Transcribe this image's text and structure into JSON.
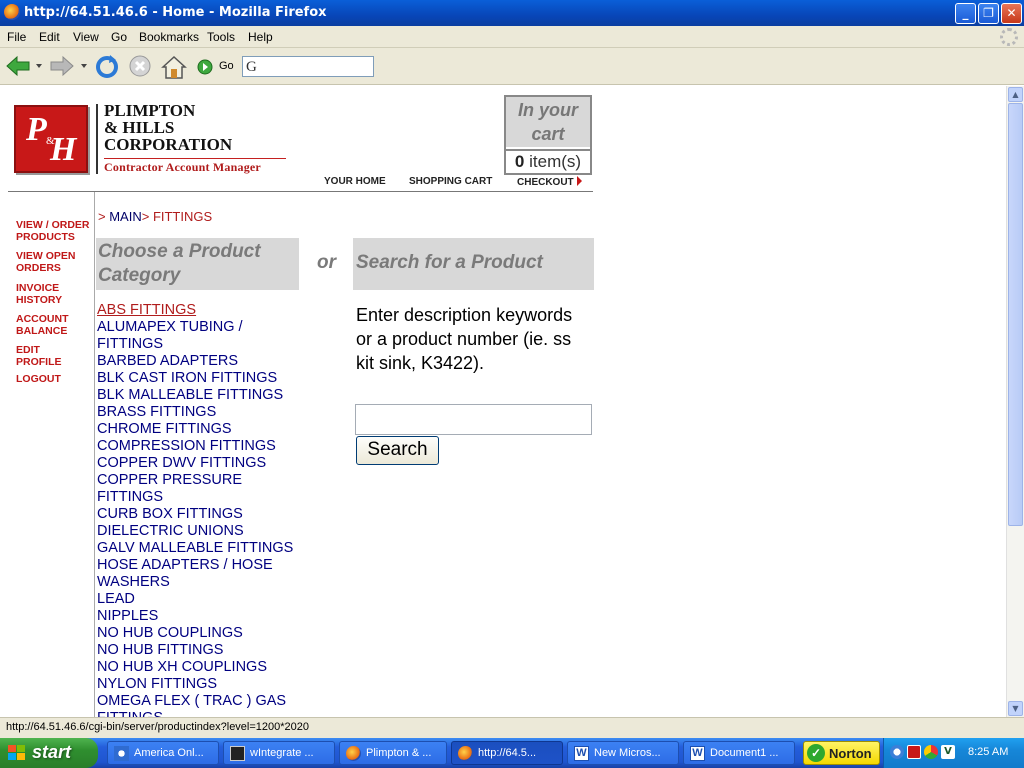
{
  "window": {
    "title": "http://64.51.46.6 - Home - Mozilla Firefox"
  },
  "menu": [
    "File",
    "Edit",
    "View",
    "Go",
    "Bookmarks",
    "Tools",
    "Help"
  ],
  "toolbar": {
    "go_label": "Go",
    "address_value": ""
  },
  "logo": {
    "initial_p": "P",
    "initial_amp": "&",
    "initial_h": "H"
  },
  "company": {
    "name": "PLIMPTON\n& HILLS\nCORPORATION",
    "tagline": "Contractor Account Manager"
  },
  "cart": {
    "heading": "In your cart",
    "count": "0",
    "unit": "item(s)"
  },
  "top_nav": {
    "home": "YOUR HOME",
    "cart": "SHOPPING CART",
    "checkout": "CHECKOUT"
  },
  "sidebar": [
    "VIEW / ORDER PRODUCTS",
    "VIEW OPEN ORDERS",
    "INVOICE HISTORY",
    "ACCOUNT BALANCE",
    "EDIT PROFILE",
    "LOGOUT"
  ],
  "breadcrumb": {
    "prefix": "> ",
    "main": "MAIN",
    "sep": "> ",
    "current": "FITTINGS"
  },
  "category_panel": {
    "heading": "Choose a Product Category",
    "or": "or",
    "items": [
      "ABS FITTINGS",
      "ALUMAPEX TUBING / FITTINGS",
      "BARBED ADAPTERS",
      "BLK CAST IRON FITTINGS",
      "BLK MALLEABLE FITTINGS",
      "BRASS FITTINGS",
      "CHROME FITTINGS",
      "COMPRESSION FITTINGS",
      "COPPER DWV FITTINGS",
      "COPPER PRESSURE FITTINGS",
      "CURB BOX FITTINGS",
      "DIELECTRIC UNIONS",
      "GALV MALLEABLE FITTINGS",
      "HOSE ADAPTERS / HOSE WASHERS",
      "LEAD",
      "NIPPLES",
      "NO HUB COUPLINGS",
      "NO HUB FITTINGS",
      "NO HUB XH COUPLINGS",
      "NYLON FITTINGS",
      "OMEGA FLEX ( TRAC ) GAS FITTINGS"
    ]
  },
  "search_panel": {
    "heading": "Search for a Product",
    "description": "Enter description keywords or a product number (ie. ss kit sink, K3422).",
    "input_value": "",
    "button": "Search"
  },
  "status": "http://64.51.46.6/cgi-bin/server/productindex?level=1200*2020",
  "taskbar": {
    "start": "start",
    "tasks": [
      "America Onl...",
      "wIntegrate ...",
      "Plimpton & ...",
      "http://64.5...",
      "New Micros...",
      "Document1 ..."
    ],
    "norton": "Norton",
    "clock": "8:25 AM"
  },
  "colors": {
    "brand_red": "#c81818",
    "link_blue": "#000080",
    "panel_gray": "#d8d8d8"
  }
}
